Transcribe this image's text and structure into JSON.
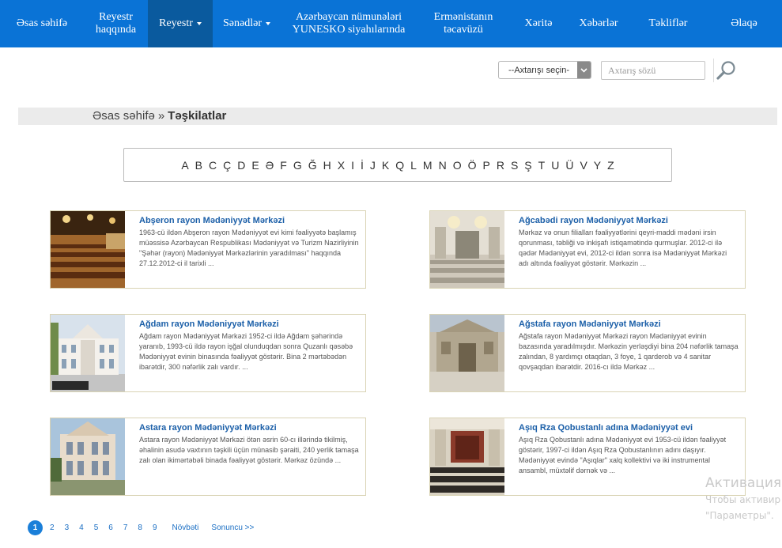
{
  "nav": {
    "items": [
      {
        "label": "Əsas səhifə"
      },
      {
        "label": "Reyestr haqqında"
      },
      {
        "label": "Reyestr",
        "dropdown": true,
        "active": true
      },
      {
        "label": "Sənədlər",
        "dropdown": true
      },
      {
        "label": "Azərbaycan nümunələri YUNESKO siyahılarında"
      },
      {
        "label": "Ermənistanın təcavüzü"
      },
      {
        "label": "Xəritə"
      },
      {
        "label": "Xəbərlər"
      },
      {
        "label": "Təkliflər"
      },
      {
        "label": "Əlaqə"
      }
    ],
    "bg_color": "#0a73d6",
    "active_color": "#0a5a9e"
  },
  "search": {
    "select_value": "--Axtarışı seçin-",
    "input_placeholder": "Axtarış sözü",
    "button_icon": "search-icon"
  },
  "breadcrumb": {
    "home": "Əsas səhifə",
    "separator": "»",
    "current": "Təşkilatlar"
  },
  "alphabet": [
    "A",
    "B",
    "C",
    "Ç",
    "D",
    "E",
    "Ə",
    "F",
    "G",
    "Ğ",
    "H",
    "X",
    "I",
    "İ",
    "J",
    "K",
    "Q",
    "L",
    "M",
    "N",
    "O",
    "Ö",
    "P",
    "R",
    "S",
    "Ş",
    "T",
    "U",
    "Ü",
    "V",
    "Y",
    "Z"
  ],
  "cards": [
    {
      "title": "Abşeron rayon Mədəniyyət Mərkəzi",
      "description": "1963-cü ildən Abşeron rayon Mədəniyyət evi kimi fəaliyyətə başlamış müəssisə Azərbaycan Respublikası Mədəniyyət və Turizm Nazirliyinin \"Şəhər (rayon) Mədəniyyət Mərkəzlərinin yaradılması\" haqqında 27.12.2012-ci il tarixli ..."
    },
    {
      "title": "Ağcabədi rayon Mədəniyyət Mərkəzi",
      "description": "Mərkəz və onun filialları fəaliyyətlərini qeyri-maddi mədəni irsin qorunması, təbliği və inkişafı istiqamətində qurmuşlar. 2012-ci ilə qədər Mədəniyyət evi, 2012-ci ildən sonra isə Mədəniyyət Mərkəzi adı altında fəaliyyət göstərir. Mərkəzin ..."
    },
    {
      "title": "Ağdam rayon Mədəniyyət Mərkəzi",
      "description": "Ağdam rayon Mədəniyyət Mərkəzi 1952-ci ildə Ağdam şəhərində yaranıb, 1993-cü ildə rayon işğal olunduqdan sonra Quzanlı qəsəbə Mədəniyyət evinin binasında fəaliyyət göstərir. Bina 2 mərtəbədən ibarətdir, 300 nəfərlik zalı vardır. ..."
    },
    {
      "title": "Ağstafa rayon Mədəniyyət Mərkəzi",
      "description": "Ağstafa rayon Mədəniyyət Mərkəzi rayon Mədəniyyət evinin bazasında yaradılmışdır. Mərkəzin yerləşdiyi bina 204 nəfərlik tamaşa zalından, 8 yardımçı otaqdan, 3 foye, 1 qarderob və 4 sanitar qovşaqdan ibarətdir. 2016-cı ildə Mərkəz ..."
    },
    {
      "title": "Astara rayon Mədəniyyət Mərkəzi",
      "description": "Astara rayon Mədəniyyət Mərkəzi ötən əsrin 60-cı illərində tikilmiş, əhalinin asudə vaxtının təşkili üçün münasib şəraiti, 240 yerlik tamaşa zalı olan ikimərtəbəli binada fəaliyyət göstərir. Mərkəz özündə ..."
    },
    {
      "title": "Aşıq Rza Qobustanlı adına Mədəniyyət evi",
      "description": "Aşıq Rza Qobustanlı adına Mədəniyyət evi 1953-cü ildən fəaliyyət göstərir, 1997-ci ildən Aşıq Rza Qobustanlının adını daşıyır. Mədəniyyət evində \"Aşıqlar\" xalq kollektivi və iki instrumental ansambl, müxtəlif dərnək və ..."
    }
  ],
  "pagination": {
    "current": "1",
    "pages": [
      "2",
      "3",
      "4",
      "5",
      "6",
      "7",
      "8",
      "9"
    ],
    "next_label": "Növbəti",
    "last_label": "Sonuncu >>"
  },
  "watermark": {
    "line1": "Активация",
    "line2": "Чтобы активир",
    "line3": "\"Параметры\"."
  }
}
